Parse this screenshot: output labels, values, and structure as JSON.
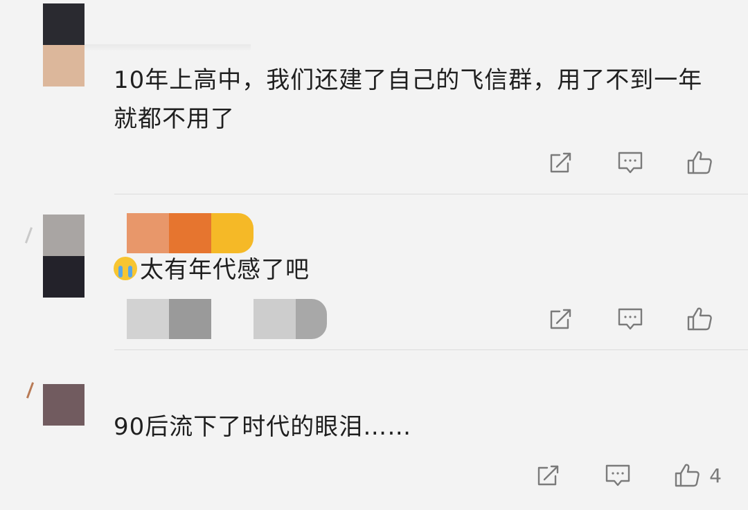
{
  "colors": {
    "background": "#f3f3f3",
    "text": "#1f1f1f",
    "icon": "#7a7a7a",
    "divider": "#dcdcdc",
    "emoji_face": "#f7c531",
    "emoji_tear": "#5aa6e6"
  },
  "icons": {
    "share": "share-icon",
    "reply": "comment-icon",
    "like": "thumbs-up-icon",
    "emoji": "loudly-crying-emoji"
  },
  "comments": [
    {
      "avatar_colors": [
        "#2a2a30",
        "#dcb79b"
      ],
      "nickname_colors": [],
      "text": "10年上高中，我们还建了自己的飞信群，用了不到一年就都不用了",
      "likes": ""
    },
    {
      "avatar_colors": [
        "#a9a5a3",
        "#23222a"
      ],
      "nickname_colors": [
        "#e8976a",
        "#e6752f",
        "#f5b927"
      ],
      "text": "太有年代感了吧",
      "likes": ""
    },
    {
      "avatar_colors": [
        "#715b5f"
      ],
      "nickname_colors": [],
      "text": "90后流下了时代的眼泪……",
      "likes": "4"
    }
  ]
}
